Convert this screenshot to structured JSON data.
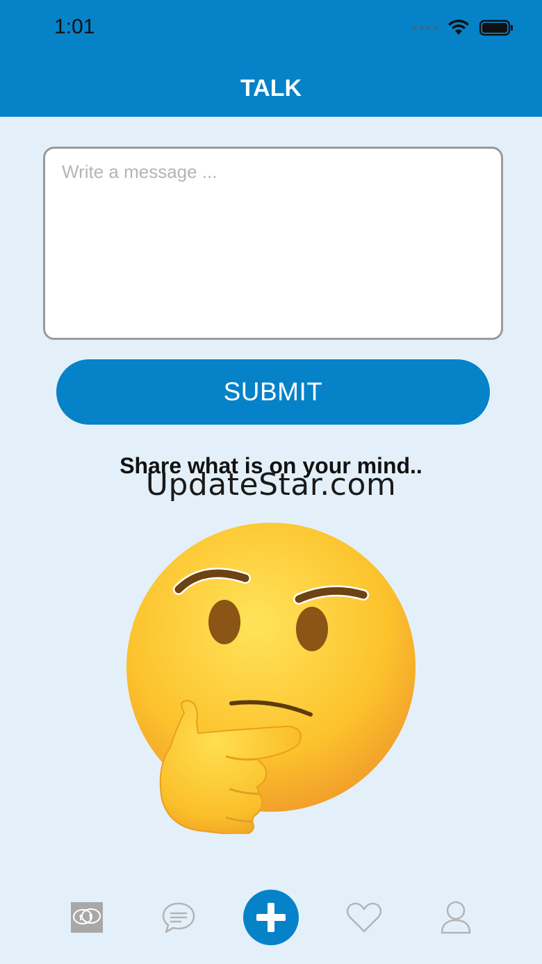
{
  "status_bar": {
    "time": "1:01"
  },
  "header": {
    "title": "TALK"
  },
  "composer": {
    "placeholder": "Write a message ...",
    "value": ""
  },
  "submit": {
    "label": "SUBMIT"
  },
  "prompt": {
    "text": "Share what is on your mind.."
  },
  "watermark": {
    "text": "UpdateStar.com"
  },
  "tabbar": {
    "items": [
      {
        "icon": "talk-logo-icon",
        "glyph": "tt"
      },
      {
        "icon": "chat-bubble-icon"
      },
      {
        "icon": "plus-icon"
      },
      {
        "icon": "heart-icon"
      },
      {
        "icon": "user-icon"
      }
    ]
  },
  "colors": {
    "accent": "#0682c8",
    "background": "#e4f0f9",
    "icon_gray": "#b4b4b4"
  }
}
